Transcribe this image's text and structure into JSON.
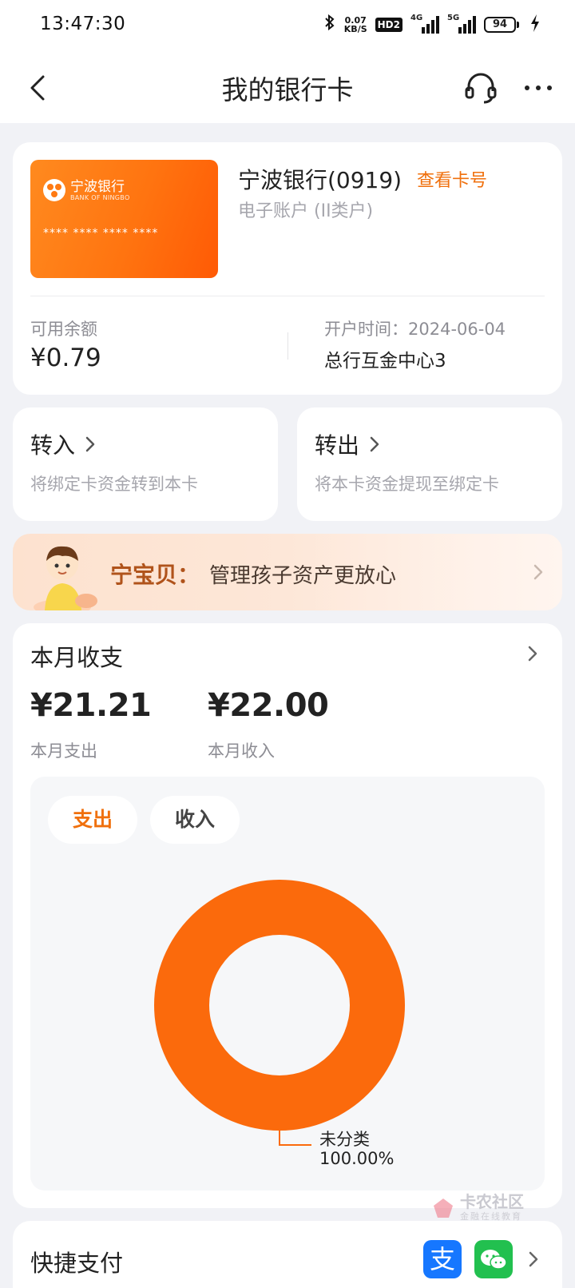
{
  "status_bar": {
    "time": "13:47:30",
    "net_speed_value": "0.07",
    "net_speed_unit": "KB/S",
    "hd_badge": "HD2",
    "signal_1": "4G",
    "signal_2": "5G",
    "battery": "94"
  },
  "nav": {
    "title": "我的银行卡"
  },
  "bank_card": {
    "logo_cn": "宁波银行",
    "logo_en": "BANK OF NINGBO",
    "masked_number": "**** **** **** ****",
    "bank_name": "宁波银行(0919)",
    "view_card_number": "查看卡号",
    "account_type": "电子账户 (II类户)",
    "balance_label": "可用余额",
    "balance_value": "¥0.79",
    "open_date": "开户时间：2024-06-04",
    "branch": "总行互金中心3"
  },
  "transfer_in": {
    "title": "转入",
    "desc": "将绑定卡资金转到本卡"
  },
  "transfer_out": {
    "title": "转出",
    "desc": "将本卡资金提现至绑定卡"
  },
  "banner": {
    "strong": "宁宝贝：",
    "text": "管理孩子资产更放心"
  },
  "monthly": {
    "title": "本月收支",
    "expense_amount": "¥21.21",
    "expense_label": "本月支出",
    "income_amount": "¥22.00",
    "income_label": "本月收入",
    "tab_expense": "支出",
    "tab_income": "收入"
  },
  "chart_data": {
    "type": "pie",
    "categories": [
      "未分类"
    ],
    "values": [
      100.0
    ],
    "labels": [
      "100.00%"
    ],
    "colors": [
      "#fb6a0c"
    ]
  },
  "quick_pay": {
    "title": "快捷支付",
    "alipay_glyph": "支"
  },
  "watermark": {
    "name": "卡农社区",
    "sub": "金融在线教育"
  },
  "colors": {
    "accent": "#f0700d",
    "chart": "#fb6a0c",
    "page_bg": "#f1f2f6"
  }
}
